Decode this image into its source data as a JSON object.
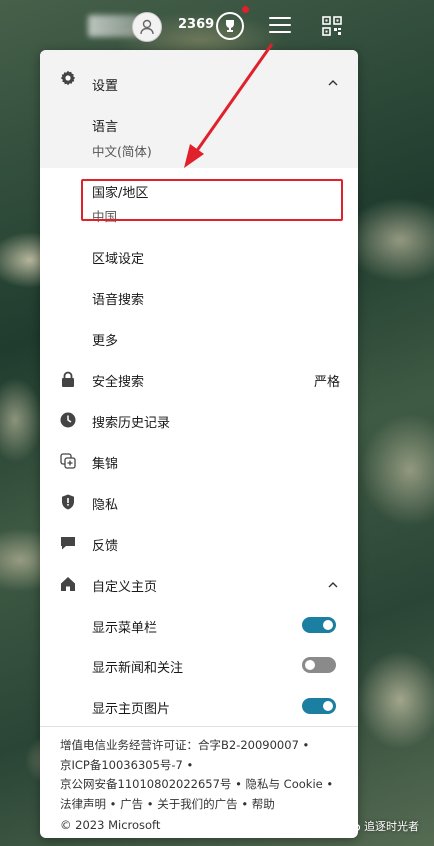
{
  "topbar": {
    "points": "2369",
    "icons": [
      "user-icon",
      "trophy-icon",
      "menu-icon",
      "qr-code-icon"
    ],
    "notification_color": "#e0202a"
  },
  "settings": {
    "title": "设置",
    "language": {
      "label": "语言",
      "value": "中文(简体)"
    },
    "region": {
      "label": "国家/地区",
      "value": "中国"
    },
    "items": [
      "区域设定",
      "语音搜索",
      "更多"
    ]
  },
  "menu": {
    "safe_search": {
      "label": "安全搜索",
      "value": "严格"
    },
    "history": "搜索历史记录",
    "collections": "集锦",
    "privacy": "隐私",
    "feedback": "反馈",
    "homepage": {
      "title": "自定义主页",
      "toggles": [
        {
          "label": "显示菜单栏",
          "state": "on"
        },
        {
          "label": "显示新闻和关注",
          "state": "off"
        },
        {
          "label": "显示主页图片",
          "state": "on"
        }
      ]
    }
  },
  "footer": {
    "line1": "增值电信业务经营许可证：合字B2-20090007 •",
    "line2": "京ICP备10036305号-7 •",
    "line3": "京公网安备11010802022657号 • 隐私与 Cookie •",
    "line4": "法律声明 • 广告 • 关于我们的广告 • 帮助",
    "line5": "© 2023 Microsoft"
  },
  "watermark": "追逐时光者",
  "colors": {
    "accent": "#1a7fa1",
    "annotation": "#e0202a"
  }
}
